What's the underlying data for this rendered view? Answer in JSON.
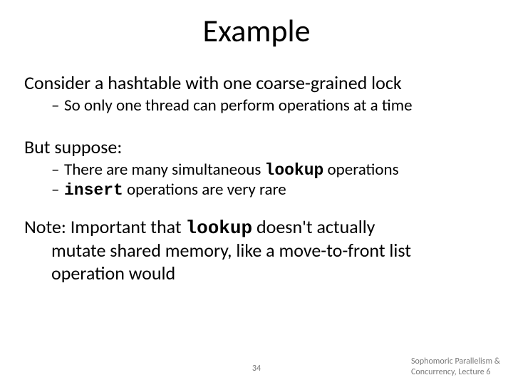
{
  "title": "Example",
  "p_consider": "Consider a hashtable with one coarse-grained lock",
  "sub_consider": "So only one thread can perform operations at a time",
  "p_suppose": "But suppose:",
  "sub_suppose_1_a": "There are many simultaneous ",
  "sub_suppose_1_code": "lookup",
  "sub_suppose_1_b": " operations",
  "sub_suppose_2_code": "insert",
  "sub_suppose_2_b": " operations are very rare",
  "note_a": "Note: Important that ",
  "note_code": "lookup",
  "note_b": " doesn't actually",
  "note_line2": "mutate shared memory, like a move-to-front list",
  "note_line3": "operation would",
  "page_number": "34",
  "footer_line1": "Sophomoric Parallelism &",
  "footer_line2": "Concurrency, Lecture 6",
  "dash": "–"
}
